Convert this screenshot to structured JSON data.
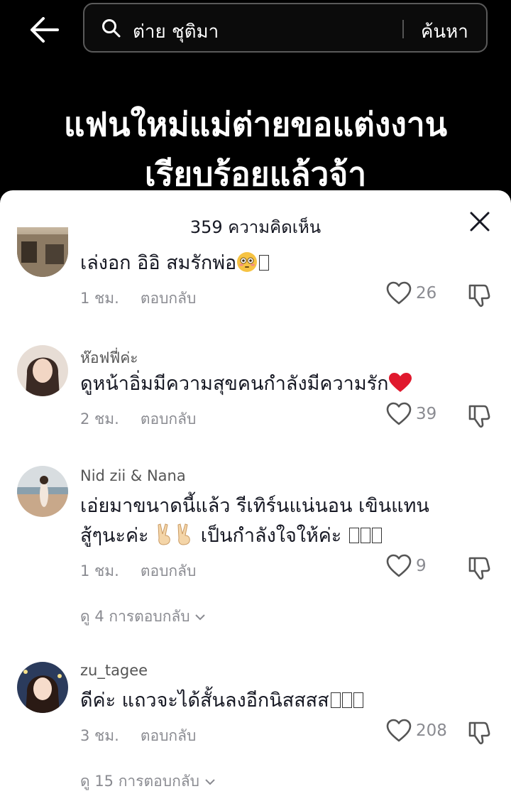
{
  "search": {
    "query": "ต่าย ชุติมา",
    "button_label": "ค้นหา"
  },
  "video": {
    "caption_line1": "แฟนใหม่แม่ต่ายขอแต่งงาน",
    "caption_line2": "เรียบร้อยแล้วจ้า"
  },
  "sheet": {
    "title": "359 ความคิดเห็น"
  },
  "comments": [
    {
      "username": "",
      "text": "เล่งอก อิอิ สมรักพ่อ",
      "time": "1 ชม.",
      "reply_label": "ตอบกลับ",
      "likes": "26"
    },
    {
      "username": "ห๊อฟฟี่ค่ะ",
      "text": "ดูหน้าอิ่มมีความสุขคนกำลังมีความรัก",
      "time": "2 ชม.",
      "reply_label": "ตอบกลับ",
      "likes": "39"
    },
    {
      "username": "Nid zii & Nana",
      "text_line1": "เอ่ยมาขนาดนี้แล้ว รีเทิร์นแน่นอน เขินแทน",
      "text_line2_a": "สู้ๆนะค่ะ",
      "text_line2_b": "เป็นกำลังใจให้ค่ะ",
      "time": "1 ชม.",
      "reply_label": "ตอบกลับ",
      "likes": "9",
      "view_replies": "ดู 4 การตอบกลับ"
    },
    {
      "username": "zu_tagee",
      "text": "ดีค่ะ แถวจะได้สั้นลงอีกนิสสสส",
      "time": "3 ชม.",
      "reply_label": "ตอบกลับ",
      "likes": "208",
      "view_replies": "ดู 15 การตอบกลับ"
    }
  ],
  "icons": {
    "back": "arrow-left-icon",
    "search": "search-icon",
    "close": "close-icon",
    "like": "heart-icon",
    "dislike": "thumbs-down-icon",
    "expand": "chevron-down-icon"
  }
}
